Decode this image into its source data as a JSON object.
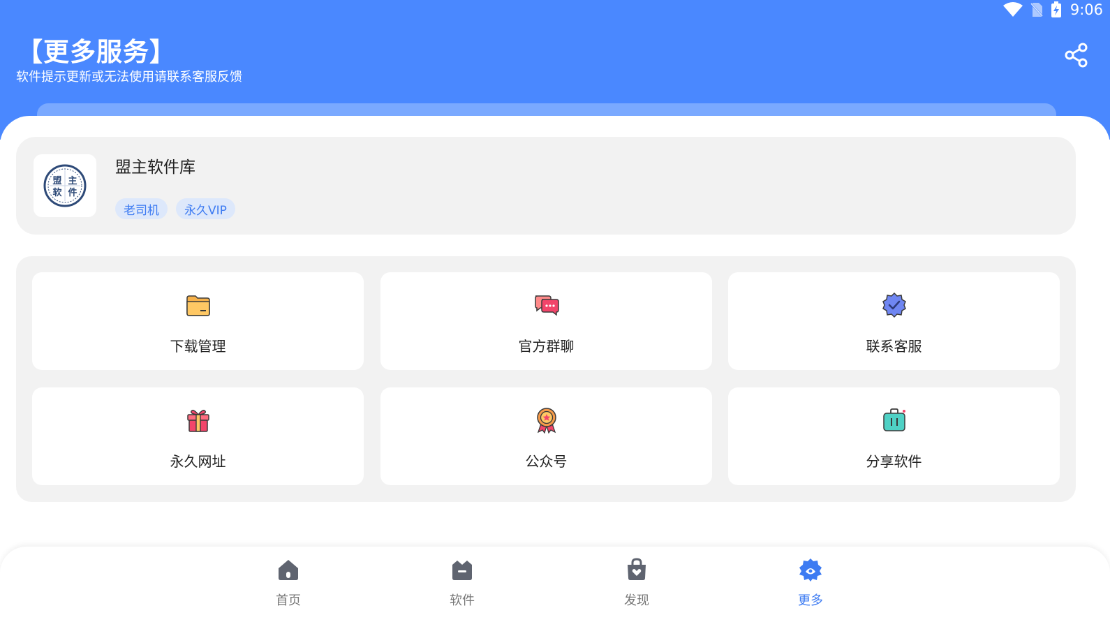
{
  "status_bar": {
    "time": "9:06"
  },
  "header": {
    "title": "【更多服务】",
    "subtitle": "软件提示更新或无法使用请联系客服反馈"
  },
  "profile": {
    "name": "盟主软件库",
    "tags": [
      "老司机",
      "永久VIP"
    ],
    "avatar_chars": [
      "盟",
      "主",
      "软",
      "件"
    ]
  },
  "services": [
    {
      "label": "下载管理",
      "icon": "folder-icon"
    },
    {
      "label": "官方群聊",
      "icon": "chat-bubbles-icon"
    },
    {
      "label": "联系客服",
      "icon": "verified-badge-icon"
    },
    {
      "label": "永久网址",
      "icon": "gift-icon"
    },
    {
      "label": "公众号",
      "icon": "award-medal-icon"
    },
    {
      "label": "分享软件",
      "icon": "suitcase-icon"
    }
  ],
  "nav": [
    {
      "label": "首页",
      "icon": "home-icon",
      "active": false
    },
    {
      "label": "软件",
      "icon": "crown-box-icon",
      "active": false
    },
    {
      "label": "发现",
      "icon": "shopping-bag-icon",
      "active": false
    },
    {
      "label": "更多",
      "icon": "flower-badge-icon",
      "active": true
    }
  ],
  "colors": {
    "header_blue": "#4a88ff",
    "accent_blue": "#3d7bf2",
    "tag_bg": "#dde8fb",
    "card_bg": "#f2f2f2"
  }
}
